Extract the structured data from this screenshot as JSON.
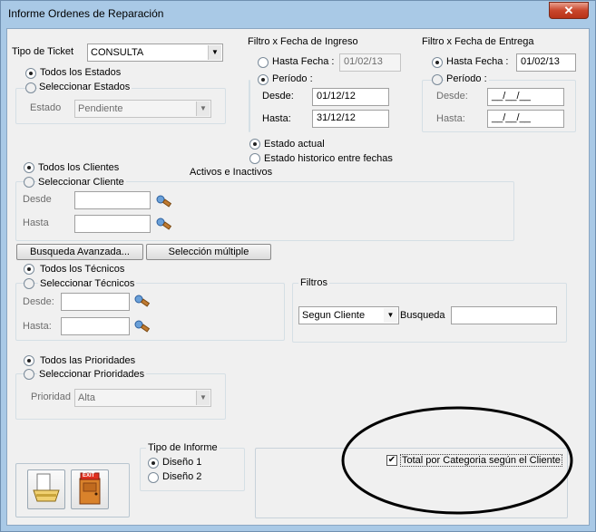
{
  "window": {
    "title": "Informe Ordenes de Reparación",
    "close_glyph": "✕"
  },
  "ticket": {
    "label": "Tipo de Ticket",
    "value": "CONSULTA"
  },
  "estados": {
    "todos": "Todos los Estados",
    "seleccionar": "Seleccionar Estados",
    "estado_label": "Estado",
    "estado_value": "Pendiente"
  },
  "ingreso": {
    "title": "Filtro x Fecha de Ingreso",
    "hasta_label": "Hasta Fecha :",
    "hasta_value": "01/02/13",
    "periodo_label": "Período :",
    "desde_label": "Desde:",
    "desde_value": "01/12/12",
    "hasta2_label": "Hasta:",
    "hasta2_value": "31/12/12"
  },
  "entrega": {
    "title": "Filtro x Fecha de Entrega",
    "hasta_label": "Hasta Fecha :",
    "hasta_value": "01/02/13",
    "periodo_label": "Período :",
    "desde_label": "Desde:",
    "desde_value": "__/__/__",
    "hasta2_label": "Hasta:",
    "hasta2_value": "__/__/__"
  },
  "estado_opts": {
    "actual": "Estado actual",
    "historico": "Estado historico entre fechas"
  },
  "clientes": {
    "todos": "Todos los Clientes",
    "seleccionar": "Seleccionar Cliente",
    "activos": "Activos e Inactivos",
    "desde": "Desde",
    "hasta": "Hasta"
  },
  "buttons": {
    "busqueda": "Busqueda Avanzada...",
    "seleccion": "Selección múltiple"
  },
  "tecnicos": {
    "todos": "Todos los Técnicos",
    "seleccionar": "Seleccionar Técnicos",
    "desde": "Desde:",
    "hasta": "Hasta:"
  },
  "filtros": {
    "title": "Filtros",
    "combo_value": "Segun Cliente",
    "busqueda_label": "Busqueda"
  },
  "prioridades": {
    "todos": "Todos las Prioridades",
    "seleccionar": "Seleccionar Prioridades",
    "prioridad_label": "Prioridad",
    "prioridad_value": "Alta"
  },
  "informe": {
    "title": "Tipo de Informe",
    "d1": "Diseño 1",
    "d2": "Diseño 2"
  },
  "total": {
    "label": "Total por Categoria según el Cliente",
    "checked": true
  },
  "exit_label": "EXIT"
}
